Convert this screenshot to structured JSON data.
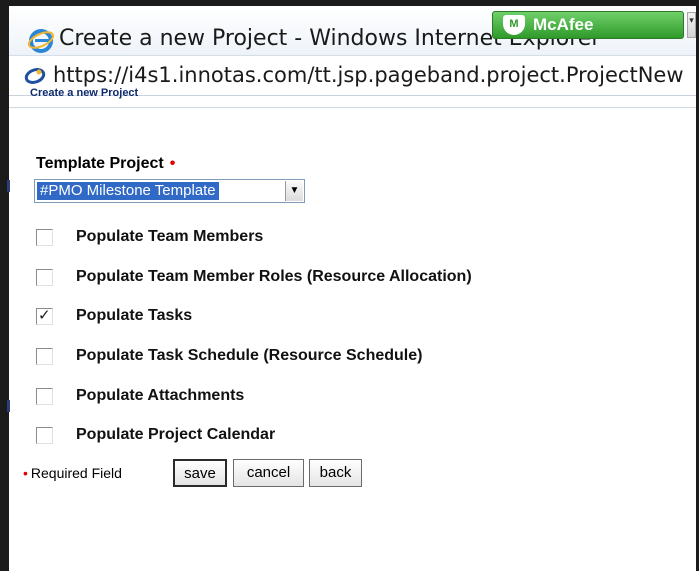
{
  "window": {
    "title": "Create a new Project - Windows Internet Explorer",
    "url": "https://i4s1.innotas.com/tt.jsp.pageband.project.ProjectNew"
  },
  "toolbar": {
    "mcafee_label": "McAfee",
    "mcafee_shield": "M"
  },
  "page": {
    "header": "Create a new Project"
  },
  "form": {
    "template_label": "Template Project",
    "required_marker": "•",
    "template_selected": "#PMO Milestone Template",
    "options": [
      {
        "label": "Populate Team Members",
        "checked": false,
        "mark": ""
      },
      {
        "label": "Populate Team Member Roles (Resource Allocation)",
        "checked": false,
        "mark": ""
      },
      {
        "label": "Populate Tasks",
        "checked": true,
        "mark": "✓"
      },
      {
        "label": "Populate Task Schedule (Resource Schedule)",
        "checked": false,
        "mark": ""
      },
      {
        "label": "Populate Attachments",
        "checked": false,
        "mark": ""
      },
      {
        "label": "Populate Project Calendar",
        "checked": false,
        "mark": ""
      }
    ],
    "required_legend": "Required Field",
    "buttons": {
      "save": "save",
      "cancel": "cancel",
      "back": "back"
    }
  },
  "colors": {
    "required": "#e00000",
    "selection": "#3169c6",
    "mcafee_green": "#2f9a2a"
  }
}
